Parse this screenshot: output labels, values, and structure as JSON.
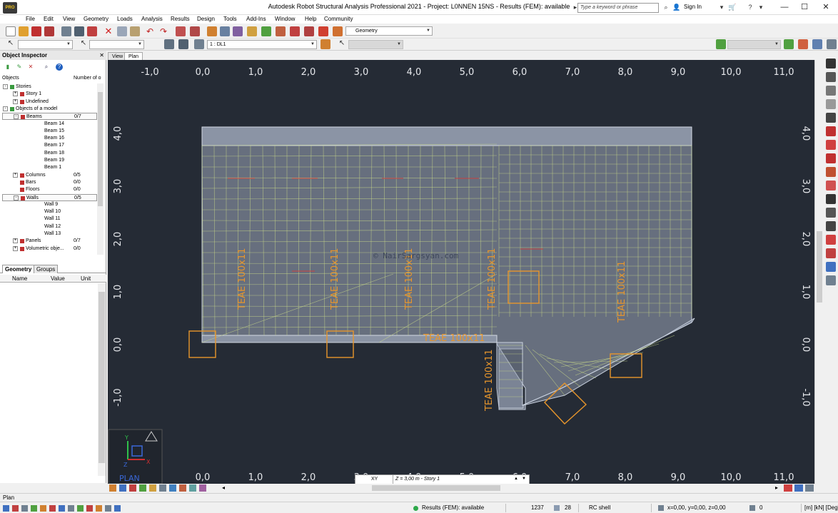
{
  "window": {
    "title": "Autodesk Robot Structural Analysis Professional 2021 - Project: L0NNEN 15NS - Results (FEM): available",
    "search_placeholder": "Type a keyword or phrase",
    "signin_label": "Sign In",
    "logo_text": "PRO"
  },
  "menu": [
    "File",
    "Edit",
    "View",
    "Geometry",
    "Loads",
    "Analysis",
    "Results",
    "Design",
    "Tools",
    "Add-Ins",
    "Window",
    "Help",
    "Community"
  ],
  "toolbar": {
    "layout_combo": "Geometry",
    "load_case_combo": "1 : DL1"
  },
  "inspector": {
    "title": "Object Inspector",
    "col_objects": "Objects",
    "col_number": "Number of o",
    "tree": [
      {
        "label": "Stories",
        "level": 0,
        "pm": "-",
        "count": ""
      },
      {
        "label": "Story 1",
        "level": 1,
        "pm": "+",
        "count": ""
      },
      {
        "label": "Undefined",
        "level": 1,
        "pm": "+",
        "count": ""
      },
      {
        "label": "Objects of a model",
        "level": 0,
        "pm": "-",
        "count": ""
      },
      {
        "label": "Beams",
        "level": 1,
        "pm": "-",
        "count": "0/7",
        "boxed": true
      },
      {
        "label": "Beam    14",
        "level": 2,
        "pm": "",
        "count": ""
      },
      {
        "label": "Beam    15",
        "level": 2,
        "pm": "",
        "count": ""
      },
      {
        "label": "Beam    16",
        "level": 2,
        "pm": "",
        "count": ""
      },
      {
        "label": "Beam    17",
        "level": 2,
        "pm": "",
        "count": ""
      },
      {
        "label": "Beam    18",
        "level": 2,
        "pm": "",
        "count": ""
      },
      {
        "label": "Beam    19",
        "level": 2,
        "pm": "",
        "count": ""
      },
      {
        "label": "Beam     1",
        "level": 2,
        "pm": "",
        "count": ""
      },
      {
        "label": "Columns",
        "level": 1,
        "pm": "+",
        "count": "0/5"
      },
      {
        "label": "Bars",
        "level": 1,
        "pm": "",
        "count": "0/0"
      },
      {
        "label": "Floors",
        "level": 1,
        "pm": "",
        "count": "0/0"
      },
      {
        "label": "Walls",
        "level": 1,
        "pm": "-",
        "count": "0/5",
        "boxed": true
      },
      {
        "label": "Wall     9",
        "level": 2,
        "pm": "",
        "count": ""
      },
      {
        "label": "Wall    10",
        "level": 2,
        "pm": "",
        "count": ""
      },
      {
        "label": "Wall    11",
        "level": 2,
        "pm": "",
        "count": ""
      },
      {
        "label": "Wall    12",
        "level": 2,
        "pm": "",
        "count": ""
      },
      {
        "label": "Wall    13",
        "level": 2,
        "pm": "",
        "count": ""
      },
      {
        "label": "Panels",
        "level": 1,
        "pm": "+",
        "count": "0/7"
      },
      {
        "label": "Volumetric obje...",
        "level": 1,
        "pm": "+",
        "count": "0/0"
      }
    ],
    "tabs": [
      "Geometry",
      "Groups"
    ],
    "grid_cols": [
      "Name",
      "Value",
      "Unit"
    ]
  },
  "view_tabs": [
    "View",
    "Plan"
  ],
  "drawing": {
    "x_ticks": [
      "-1,0",
      "0,0",
      "1,0",
      "2,0",
      "3,0",
      "4,0",
      "5,0",
      "6,0",
      "7,0",
      "8,0",
      "9,0",
      "10,0",
      "11,0"
    ],
    "y_ticks": [
      "4,0",
      "3,0",
      "2,0",
      "1,0",
      "0,0",
      "-1,0"
    ],
    "beam_labels": [
      "TEAE 100x11",
      "TEAE 100x11",
      "TEAE 100x11",
      "TEAE 100x11",
      "TEAE 100x11",
      "TEAE 100x11",
      "TEAE 100x11"
    ],
    "watermark": "© NairSargsyan.com",
    "plan_label": "PLAN",
    "axis_x": "X",
    "axis_y": "Y",
    "axis_z": "Z",
    "colors": {
      "background": "#252b35",
      "slab": "#8f99ab",
      "mesh": "#c9d98a",
      "labels": "#e8962c",
      "ticks": "#e6e8ec"
    }
  },
  "bottom": {
    "xy_label": "XY",
    "z_label": "Z = 3,00 m - Story 1",
    "view_name": "Plan"
  },
  "status": {
    "results": "Results (FEM): available",
    "nodes": "1237",
    "elements": "28",
    "section": "RC shell",
    "coords": "x=0,00, y=0,00, z=0,00",
    "zero": "0",
    "units": "[m] [kN] [Deg]"
  }
}
